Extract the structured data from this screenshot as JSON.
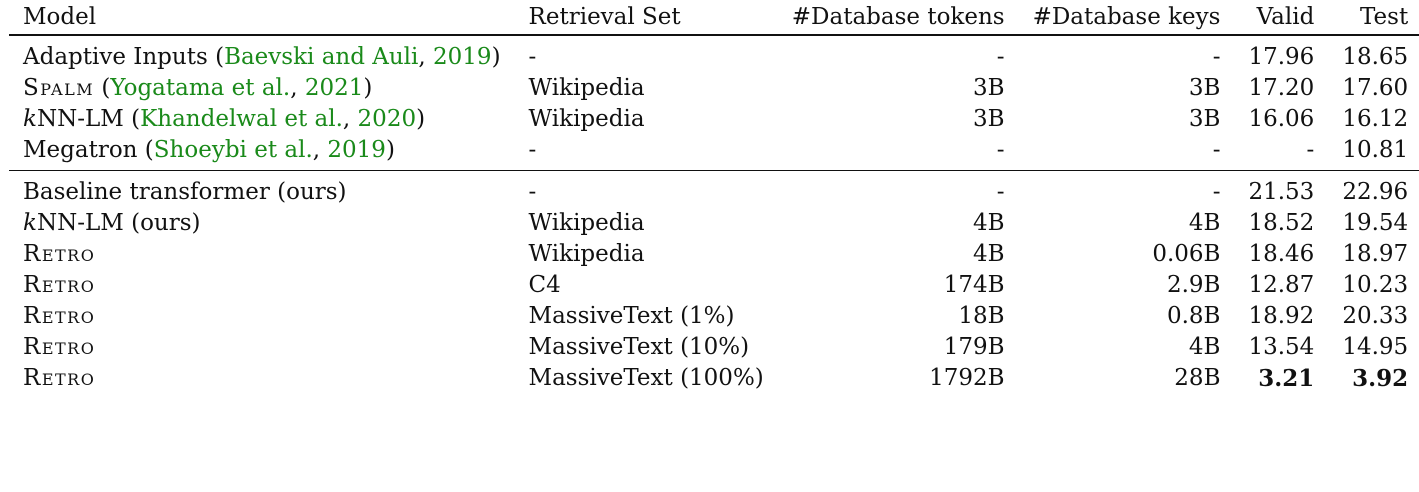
{
  "headers": {
    "model": "Model",
    "retrieval_set": "Retrieval Set",
    "db_tokens": "#Database tokens",
    "db_keys": "#Database keys",
    "valid": "Valid",
    "test": "Test"
  },
  "group1": [
    {
      "name": "Adaptive Inputs",
      "open": " (",
      "cite_author": "Baevski and Auli",
      "sep": ", ",
      "cite_year": "2019",
      "close": ")",
      "retrieval_set": "-",
      "db_tokens": "-",
      "db_keys": "-",
      "valid": "17.96",
      "test": "18.65"
    },
    {
      "name": "Spalm",
      "open": " (",
      "cite_author": "Yogatama et al.",
      "sep": ", ",
      "cite_year": "2021",
      "close": ")",
      "retrieval_set": "Wikipedia",
      "db_tokens": "3B",
      "db_keys": "3B",
      "valid": "17.20",
      "test": "17.60"
    },
    {
      "name_italic": "k",
      "name": "NN-LM",
      "open": " (",
      "cite_author": "Khandelwal et al.",
      "sep": ", ",
      "cite_year": "2020",
      "close": ")",
      "retrieval_set": "Wikipedia",
      "db_tokens": "3B",
      "db_keys": "3B",
      "valid": "16.06",
      "test": "16.12"
    },
    {
      "name": "Megatron",
      "open": " (",
      "cite_author": "Shoeybi et al.",
      "sep": ", ",
      "cite_year": "2019",
      "close": ")",
      "retrieval_set": "-",
      "db_tokens": "-",
      "db_keys": "-",
      "valid": "-",
      "test": "10.81"
    }
  ],
  "group2": [
    {
      "name": "Baseline transformer (ours)",
      "retrieval_set": "-",
      "db_tokens": "-",
      "db_keys": "-",
      "valid": "21.53",
      "test": "22.96"
    },
    {
      "name_italic": "k",
      "name": "NN-LM (ours)",
      "retrieval_set": "Wikipedia",
      "db_tokens": "4B",
      "db_keys": "4B",
      "valid": "18.52",
      "test": "19.54"
    },
    {
      "name": "Retro",
      "retrieval_set": "Wikipedia",
      "db_tokens": "4B",
      "db_keys": "0.06B",
      "valid": "18.46",
      "test": "18.97"
    },
    {
      "name": "Retro",
      "retrieval_set": "C4",
      "db_tokens": "174B",
      "db_keys": "2.9B",
      "valid": "12.87",
      "test": "10.23"
    },
    {
      "name": "Retro",
      "retrieval_set": "MassiveText (1%)",
      "db_tokens": "18B",
      "db_keys": "0.8B",
      "valid": "18.92",
      "test": "20.33"
    },
    {
      "name": "Retro",
      "retrieval_set": "MassiveText (10%)",
      "db_tokens": "179B",
      "db_keys": "4B",
      "valid": "13.54",
      "test": "14.95"
    },
    {
      "name": "Retro",
      "retrieval_set": "MassiveText (100%)",
      "db_tokens": "1792B",
      "db_keys": "28B",
      "valid": "3.21",
      "test": "3.92"
    }
  ],
  "colors": {
    "citation": "#1a8a1a",
    "text": "#111111",
    "rule": "#111111"
  }
}
